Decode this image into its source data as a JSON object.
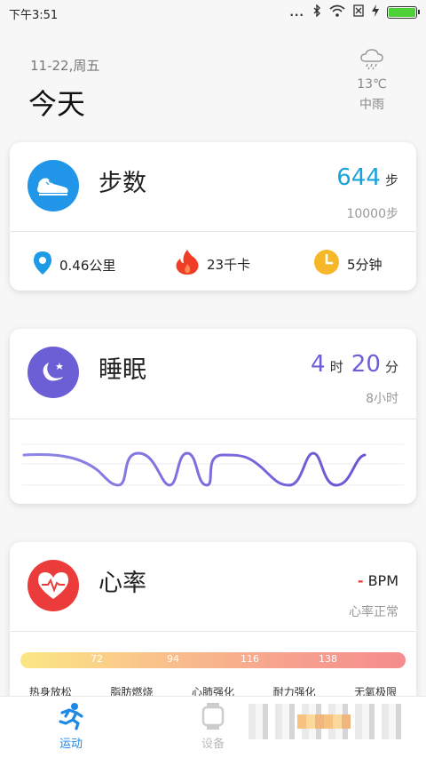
{
  "status_bar": {
    "time": "下午3:51",
    "signal_text": "...",
    "icons": [
      "bluetooth-icon",
      "wifi-icon",
      "sim-x-icon",
      "charging-icon",
      "battery-icon"
    ]
  },
  "header": {
    "date": "11-22,周五",
    "title": "今天",
    "weather": {
      "icon": "rain-cloud-icon",
      "temp": "13℃",
      "desc": "中雨"
    }
  },
  "steps": {
    "title": "步数",
    "value": "644",
    "unit": "步",
    "goal": "10000步",
    "distance": "0.46公里",
    "calories": "23千卡",
    "duration": "5分钟",
    "colors": {
      "accent": "#1aa3d9"
    }
  },
  "sleep": {
    "title": "睡眠",
    "hours": "4",
    "hours_unit": "时",
    "minutes": "20",
    "minutes_unit": "分",
    "goal": "8小时",
    "colors": {
      "accent": "#6c5fd6"
    }
  },
  "heart": {
    "title": "心率",
    "value": "-",
    "unit": "BPM",
    "status": "心率正常",
    "thresholds": [
      "72",
      "94",
      "116",
      "138"
    ],
    "zones": [
      "热身放松",
      "脂肪燃烧",
      "心肺强化",
      "耐力强化",
      "无氧极限"
    ]
  },
  "nav": {
    "items": [
      {
        "label": "运动",
        "icon": "running-icon",
        "active": true
      },
      {
        "label": "设备",
        "icon": "watch-icon",
        "active": false
      }
    ]
  }
}
